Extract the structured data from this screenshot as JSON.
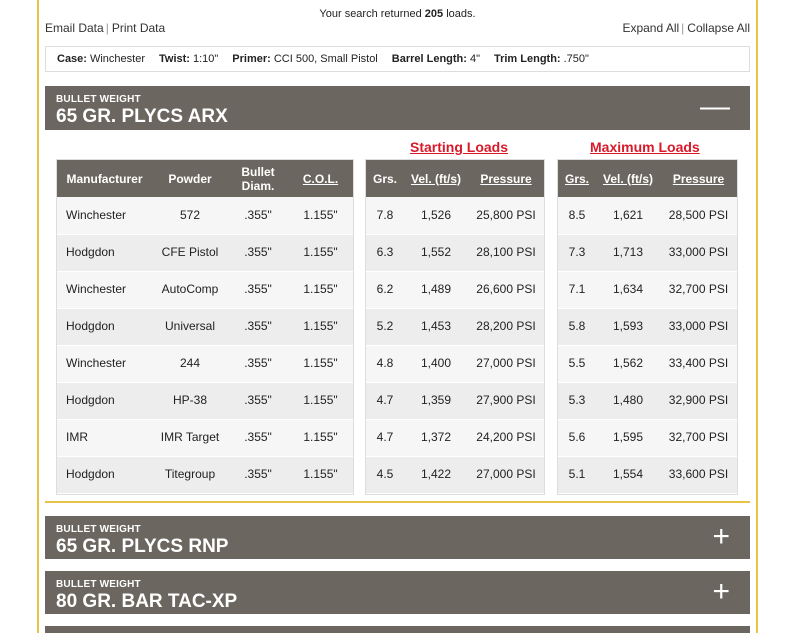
{
  "header": {
    "search_prefix": "Your search returned",
    "search_count": "205",
    "search_suffix": "loads.",
    "email_data": "Email Data",
    "print_data": "Print Data",
    "expand_all": "Expand All",
    "collapse_all": "Collapse All"
  },
  "criteria": [
    {
      "label": "Case:",
      "value": "Winchester"
    },
    {
      "label": "Twist:",
      "value": "1:10\""
    },
    {
      "label": "Primer:",
      "value": "CCI 500, Small Pistol"
    },
    {
      "label": "Barrel Length:",
      "value": "4\""
    },
    {
      "label": "Trim Length:",
      "value": ".750\""
    }
  ],
  "sections": [
    {
      "sub": "BULLET WEIGHT",
      "title": "65 GR. PLYCS ARX",
      "toggle": "—"
    },
    {
      "sub": "BULLET WEIGHT",
      "title": "65 GR. PLYCS RNP",
      "toggle": "+"
    },
    {
      "sub": "BULLET WEIGHT",
      "title": "80 GR. BAR TAC-XP",
      "toggle": "+"
    }
  ],
  "table": {
    "starting_label": "Starting Loads",
    "maximum_label": "Maximum Loads",
    "left_headers": [
      "Manufacturer",
      "Powder",
      "Bullet Diam.",
      "C.O.L."
    ],
    "start_headers": [
      "Grs.",
      "Vel. (ft/s)",
      "Pressure"
    ],
    "max_headers": [
      "Grs.",
      "Vel. (ft/s)",
      "Pressure"
    ],
    "rows": [
      {
        "mfr": "Winchester",
        "powder": "572",
        "diam": ".355\"",
        "col": "1.155\"",
        "s_grs": "7.8",
        "s_vel": "1,526",
        "s_pres": "25,800 PSI",
        "m_grs": "8.5",
        "m_vel": "1,621",
        "m_pres": "28,500 PSI"
      },
      {
        "mfr": "Hodgdon",
        "powder": "CFE Pistol",
        "diam": ".355\"",
        "col": "1.155\"",
        "s_grs": "6.3",
        "s_vel": "1,552",
        "s_pres": "28,100 PSI",
        "m_grs": "7.3",
        "m_vel": "1,713",
        "m_pres": "33,000 PSI"
      },
      {
        "mfr": "Winchester",
        "powder": "AutoComp",
        "diam": ".355\"",
        "col": "1.155\"",
        "s_grs": "6.2",
        "s_vel": "1,489",
        "s_pres": "26,600 PSI",
        "m_grs": "7.1",
        "m_vel": "1,634",
        "m_pres": "32,700 PSI"
      },
      {
        "mfr": "Hodgdon",
        "powder": "Universal",
        "diam": ".355\"",
        "col": "1.155\"",
        "s_grs": "5.2",
        "s_vel": "1,453",
        "s_pres": "28,200 PSI",
        "m_grs": "5.8",
        "m_vel": "1,593",
        "m_pres": "33,000 PSI"
      },
      {
        "mfr": "Winchester",
        "powder": "244",
        "diam": ".355\"",
        "col": "1.155\"",
        "s_grs": "4.8",
        "s_vel": "1,400",
        "s_pres": "27,000 PSI",
        "m_grs": "5.5",
        "m_vel": "1,562",
        "m_pres": "33,400 PSI"
      },
      {
        "mfr": "Hodgdon",
        "powder": "HP-38",
        "diam": ".355\"",
        "col": "1.155\"",
        "s_grs": "4.7",
        "s_vel": "1,359",
        "s_pres": "27,900 PSI",
        "m_grs": "5.3",
        "m_vel": "1,480",
        "m_pres": "32,900 PSI"
      },
      {
        "mfr": "IMR",
        "powder": "IMR Target",
        "diam": ".355\"",
        "col": "1.155\"",
        "s_grs": "4.7",
        "s_vel": "1,372",
        "s_pres": "24,200 PSI",
        "m_grs": "5.6",
        "m_vel": "1,595",
        "m_pres": "32,700 PSI"
      },
      {
        "mfr": "Hodgdon",
        "powder": "Titegroup",
        "diam": ".355\"",
        "col": "1.155\"",
        "s_grs": "4.5",
        "s_vel": "1,422",
        "s_pres": "27,000 PSI",
        "m_grs": "5.1",
        "m_vel": "1,554",
        "m_pres": "33,600 PSI"
      }
    ]
  },
  "colors": {
    "accent_gold": "#e8c34a",
    "header_gray": "#6b665f",
    "load_red": "#d81a2a"
  }
}
